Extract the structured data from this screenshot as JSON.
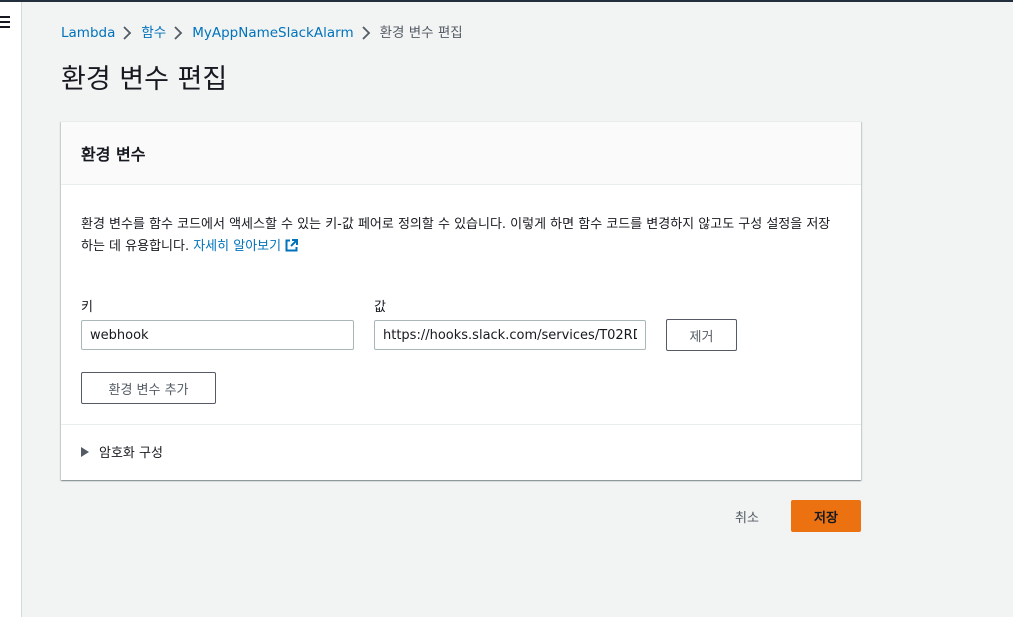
{
  "breadcrumb": {
    "items": [
      "Lambda",
      "함수",
      "MyAppNameSlackAlarm"
    ],
    "current": "환경 변수 편집"
  },
  "page": {
    "title": "환경 변수 편집"
  },
  "panel": {
    "title": "환경 변수",
    "description": "환경 변수를 함수 코드에서 액세스할 수 있는 키-값 페어로 정의할 수 있습니다. 이렇게 하면 함수 코드를 변경하지 않고도 구성 설정을 저장하는 데 유용합니다.",
    "learn_more": "자세히 알아보기",
    "key_label": "키",
    "value_label": "값",
    "rows": [
      {
        "key": "webhook",
        "value": "https://hooks.slack.com/services/T02RD"
      }
    ],
    "remove_label": "제거",
    "add_label": "환경 변수 추가",
    "encryption_label": "암호화 구성"
  },
  "actions": {
    "cancel": "취소",
    "save": "저장"
  },
  "colors": {
    "primary": "#ec7211",
    "link": "#0073bb"
  }
}
